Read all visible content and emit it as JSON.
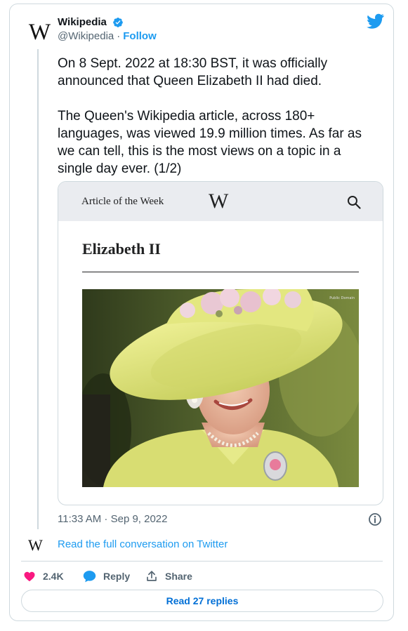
{
  "account": {
    "avatar_glyph": "W",
    "display_name": "Wikipedia",
    "handle": "@Wikipedia",
    "separator": "·",
    "follow_label": "Follow"
  },
  "tweet": {
    "paragraph1": "On 8 Sept. 2022 at 18:30 BST, it was officially announced that Queen Elizabeth II had died.",
    "paragraph2": "The Queen's Wikipedia article, across 180+ languages, was viewed 19.9 million times. As far as we can tell, this is the most views on a topic in a single day ever. (1/2)",
    "timestamp": "11:33 AM · Sep 9, 2022"
  },
  "media_card": {
    "header_label": "Article of the Week",
    "logo_glyph": "W",
    "article_title": "Elizabeth II",
    "photo_credit": "Public Domain"
  },
  "conversation": {
    "logo_glyph": "W",
    "link_label": "Read the full conversation on Twitter"
  },
  "actions": {
    "likes": "2.4K",
    "reply_label": "Reply",
    "share_label": "Share"
  },
  "read_replies_label": "Read 27 replies",
  "colors": {
    "accent": "#1d9bf0",
    "like": "#f91880",
    "muted": "#536471",
    "border": "#cfd9de"
  },
  "icons": [
    "verified-badge-icon",
    "twitter-bird-icon",
    "search-icon",
    "info-icon",
    "heart-icon",
    "reply-bubble-icon",
    "share-icon"
  ]
}
